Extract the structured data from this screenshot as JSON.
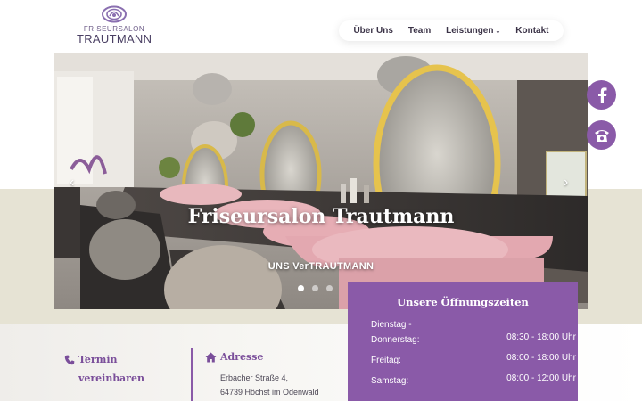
{
  "brand": {
    "logo_small": "FRISEURSALON",
    "logo_big": "TRAUTMANN",
    "accent_color": "#8a5aa8"
  },
  "nav": {
    "items": [
      {
        "label": "Über Uns"
      },
      {
        "label": "Team"
      },
      {
        "label": "Leistungen",
        "has_dropdown": true
      },
      {
        "label": "Kontakt"
      }
    ]
  },
  "hero": {
    "title": "Friseursalon Trautmann",
    "subtitle": "UNS VerTRAUTMANN",
    "slide_count": 3,
    "active_slide": 1
  },
  "social": {
    "facebook_icon": "facebook-icon",
    "phone_icon": "phone-icon"
  },
  "hours": {
    "title": "Unsere Öffnungszeiten",
    "rows": [
      {
        "day_line1": "Dienstag -",
        "day_line2": "Donnerstag:",
        "time": "08:30 - 18:00 Uhr"
      },
      {
        "day_line1": "Freitag:",
        "time": "08:00 - 18:00 Uhr"
      },
      {
        "day_line1": "Samstag:",
        "time": "08:00 - 12:00 Uhr"
      }
    ]
  },
  "termin": {
    "icon": "phone-icon",
    "title_line1": "Termin",
    "title_line2": "vereinbaren"
  },
  "adresse": {
    "icon": "home-icon",
    "title": "Adresse",
    "line1": "Erbacher Straße 4,",
    "line2": "64739 Höchst im Odenwald"
  }
}
